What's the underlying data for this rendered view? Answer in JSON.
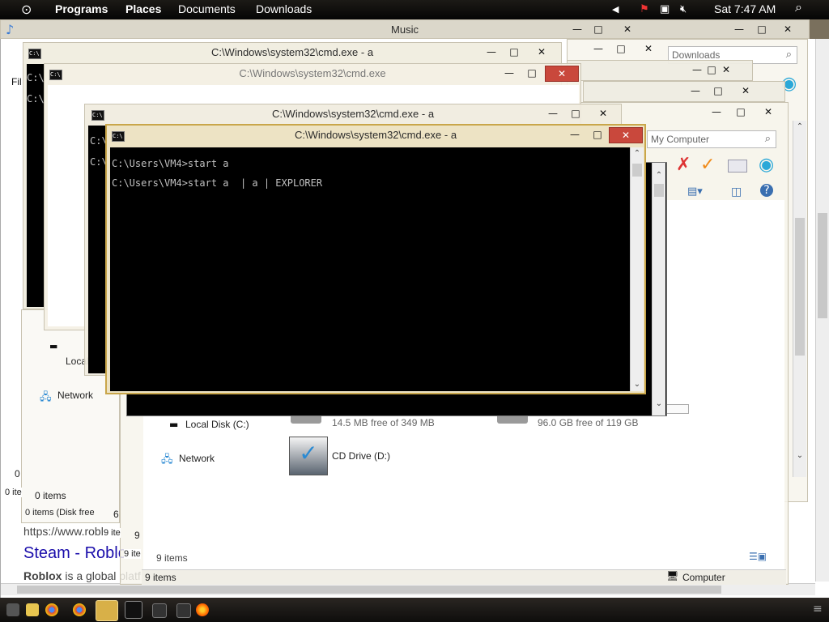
{
  "top_panel": {
    "menu": [
      "Programs",
      "Places",
      "Documents",
      "Downloads"
    ],
    "clock": "Sat  7:47 AM"
  },
  "music_window": {
    "title": "Music"
  },
  "browser_bg": {
    "url": "https://www.robl",
    "link": "Steam - Roblo",
    "desc_bold": "Roblox",
    "desc_rest": " is a global platf",
    "fil_label": "Fil"
  },
  "explorer_back": {
    "search_placeholder": "Downloads",
    "search_placeholder2": "My Computer",
    "status_items_a": "0 items",
    "status_items_b": "0 items (Disk free",
    "status_items_c": "9 ite",
    "status_items_d": "9 ite",
    "status_items_e": "0 ite",
    "status_num_6": "6",
    "status_num_0": "0",
    "status_num_9": "9",
    "local_label": "Local",
    "network_label": "Network"
  },
  "explorer_front": {
    "local_disk_label": "Local Disk (C:)",
    "network_label": "Network",
    "drive_c_free": "14.5 MB free of 349 MB",
    "drive_d_free": "96.0 GB free of 119 GB",
    "cd_drive": "CD Drive (D:)",
    "items": "9 items",
    "items_status": "9 items",
    "location": "Computer"
  },
  "cmd_windows": {
    "title": "C:\\Windows\\system32\\cmd.exe - a",
    "title_ghost": "C:\\Windows\\system32\\cmd.exe",
    "prompt_stub": "C:\\",
    "line1": "C:\\Users\\VM4>start a",
    "line2": "C:\\Users\\VM4>start a  | a | EXPLORER"
  },
  "window_controls": {
    "min": "—",
    "max": "□",
    "close": "✕"
  },
  "colors": {
    "panel": "#0b0a09",
    "cmd_border": "#c9a64a",
    "close_red": "#c9483c",
    "link_blue": "#1a0dab"
  }
}
